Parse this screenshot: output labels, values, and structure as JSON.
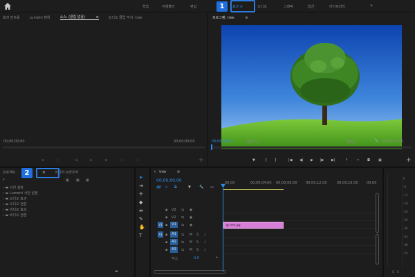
{
  "workspace": {
    "tabs": [
      "학습",
      "어셈블리",
      "편집",
      "효과",
      "오디오",
      "그래픽",
      "캡션",
      "라이브러리"
    ],
    "more": "»",
    "active_index": 3
  },
  "callouts": {
    "one": "1",
    "two": "2"
  },
  "source_panel": {
    "tabs": [
      "효과 컨트롤",
      "Lumetri 범위",
      "소스: (클립 없음)",
      "오디오 클립 믹서: tree"
    ],
    "timecode_left": "00;00;00;00",
    "timecode_right": "00;00;00;00"
  },
  "program_panel": {
    "title": "프로그램: tree",
    "timecode_left": "00;00;00;00",
    "fit": "맞추기",
    "quality": "전체",
    "timecode_right": "00;00;07;28"
  },
  "project_panel": {
    "tabs": [
      "프로젝트",
      "효과",
      "미디어 브라우저"
    ],
    "tree": [
      "사전 설정",
      "Lumetri 사전 설정",
      "오디오 효과",
      "오디오 전환",
      "비디오 효과",
      "비디오 전환"
    ]
  },
  "timeline": {
    "sequence": "tree",
    "timecode": "00;00;00;00",
    "ruler": [
      "00;00",
      "00;00;04;00",
      "00;00;08;00",
      "00;00;12;00",
      "00;00;16;00",
      "00;00"
    ],
    "video_tracks": [
      "V3",
      "V2",
      "V1"
    ],
    "audio_tracks": [
      "A1",
      "A2",
      "A3"
    ],
    "track_letters": {
      "video": "V1",
      "audio": "A1"
    },
    "mix_label": "믹스",
    "mix_value": "0.0",
    "clip_label": "tree.jpg"
  },
  "meter": {
    "scale": [
      "0",
      "-6",
      "-12",
      "-18",
      "-24",
      "-30",
      "-36",
      "-42",
      "-48",
      "-54"
    ],
    "solo": "S"
  },
  "colors": {
    "accent": "#2d8ceb",
    "clip": "#d77fd7",
    "playhead": "#2d8ceb"
  }
}
